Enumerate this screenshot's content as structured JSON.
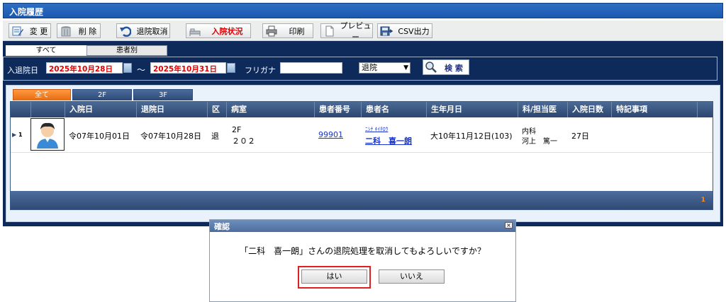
{
  "window": {
    "title": "入院履歴"
  },
  "toolbar": {
    "edit": "変 更",
    "delete": "削 除",
    "cancel_discharge": "退院取消",
    "admission_status": "入院状況",
    "print": "印刷",
    "preview": "プレビュー",
    "csv": "CSV出力"
  },
  "filter": {
    "tab_all": "すべて",
    "tab_by_patient": "患者別",
    "date_label": "入退院日",
    "date_from": "2025年10月28日",
    "date_sep": "〜",
    "date_to": "2025年10月31日",
    "kana_label": "フリガナ",
    "kana_value": "",
    "type_select": "退院",
    "search_button": "検 索"
  },
  "floor_tabs": [
    "全て",
    "2F",
    "3F"
  ],
  "table": {
    "headers": [
      "入院日",
      "退院日",
      "区",
      "病室",
      "患者番号",
      "患者名",
      "生年月日",
      "科/担当医",
      "入院日数",
      "特記事項"
    ],
    "rows": [
      {
        "row_no": "1",
        "admit_date": "令07年10月01日",
        "discharge_date": "令07年10月28日",
        "ward_type": "退",
        "room_floor": "2F",
        "room_no": "２０２",
        "patient_no": "99901",
        "kana": "ﾆｼﾅ ｷｲﾁﾛｳ",
        "name": "二科　喜一朗",
        "birth": "大10年11月12日(103)",
        "dept": "内科",
        "doctor": "河上　篤一",
        "days": "27日",
        "notes": ""
      }
    ],
    "footer_mark": "1"
  },
  "dialog": {
    "title": "確認",
    "message": "「二科　喜一朗」さんの退院処理を取消してもよろしいですか？",
    "yes": "はい",
    "no": "いいえ"
  },
  "colors": {
    "title_bar": "#1c59b0",
    "panel": "#0d2a5a",
    "date_text": "#e00000",
    "tab_active": "#f07820",
    "highlight": "#e02020"
  }
}
